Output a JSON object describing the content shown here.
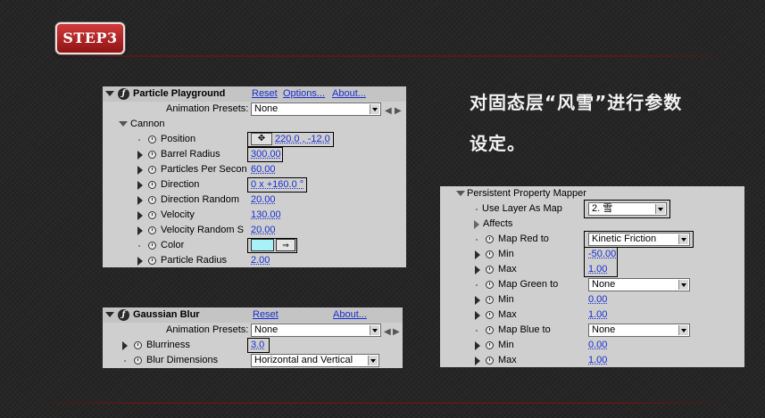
{
  "step_label": "STEP3",
  "caption": {
    "line1": "对固态层“风雪”进行参数",
    "line2": "设定。"
  },
  "particle_panel": {
    "effect_name": "Particle Playground",
    "reset": "Reset",
    "options": "Options...",
    "about": "About...",
    "presets_label": "Animation Presets:",
    "presets_value": "None",
    "group_label": "Cannon",
    "position_label": "Position",
    "position_value": "220.0 , -12.0",
    "barrel_radius_label": "Barrel Radius",
    "barrel_radius_value": "300.00",
    "particles_per_second_label": "Particles Per Secon",
    "particles_per_second_value": "60.00",
    "direction_label": "Direction",
    "direction_value": "0 x +160.0 °",
    "direction_random_label": "Direction Random",
    "direction_random_value": "20.00",
    "velocity_label": "Velocity",
    "velocity_value": "130.00",
    "velocity_random_label": "Velocity Random S",
    "velocity_random_value": "20.00",
    "color_label": "Color",
    "color_hex": "#a9f1f8",
    "particle_radius_label": "Particle Radius",
    "particle_radius_value": "2.00"
  },
  "blur_panel": {
    "effect_name": "Gaussian Blur",
    "reset": "Reset",
    "about": "About...",
    "presets_label": "Animation Presets:",
    "presets_value": "None",
    "blurriness_label": "Blurriness",
    "blurriness_value": "3.0",
    "dimensions_label": "Blur Dimensions",
    "dimensions_value": "Horizontal and Vertical"
  },
  "mapper_panel": {
    "group_label": "Persistent Property Mapper",
    "use_layer_label": "Use Layer As Map",
    "use_layer_value": "2. 雪",
    "affects_label": "Affects",
    "map_red_label": "Map Red to",
    "map_red_value": "Kinetic Friction",
    "red_min_label": "Min",
    "red_min_value": "-50.00",
    "red_max_label": "Max",
    "red_max_value": "1.00",
    "map_green_label": "Map Green to",
    "map_green_value": "None",
    "green_min_label": "Min",
    "green_min_value": "0.00",
    "green_max_label": "Max",
    "green_max_value": "1.00",
    "map_blue_label": "Map Blue to",
    "map_blue_value": "None",
    "blue_min_label": "Min",
    "blue_min_value": "0.00",
    "blue_max_label": "Max",
    "blue_max_value": "1.00"
  }
}
